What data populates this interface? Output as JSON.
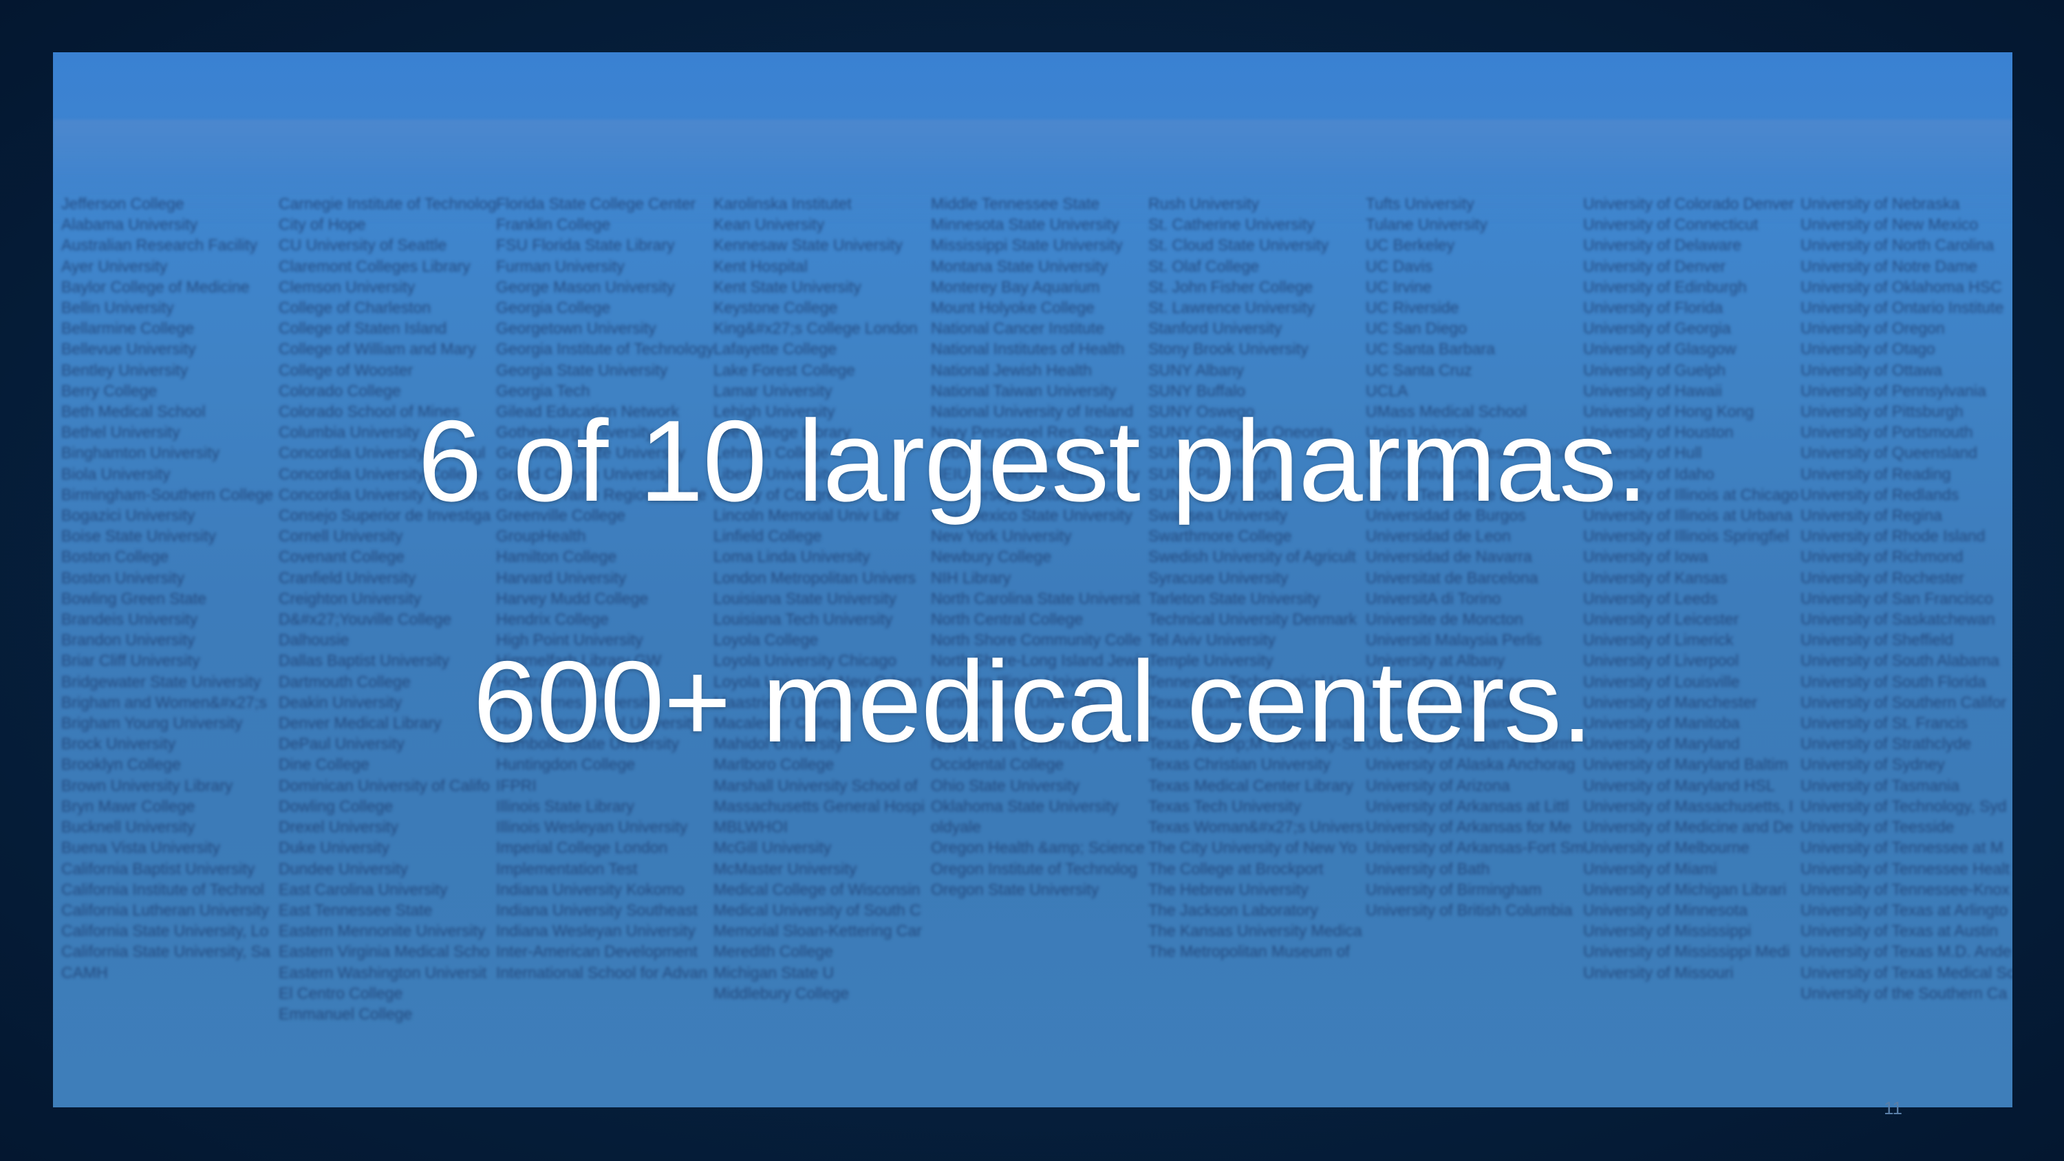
{
  "slide": {
    "headline_1": "6 of 10 largest pharmas.",
    "headline_2": "600+ medical centers.",
    "slide_number": "11"
  },
  "colors": {
    "outer_background": "#06203d",
    "slide_background": "#3d7cbb",
    "headline_text": "#ffffff",
    "list_text": "#1e3f73"
  },
  "institution_columns": [
    {
      "items": [
        "Jefferson College",
        "Alabama University",
        "Australian Research Facility",
        "Ayer University",
        "Baylor College of Medicine",
        "Bellin University",
        "Bellarmine College",
        "Bellevue University",
        "Bentley University",
        "Berry College",
        "Beth Medical School",
        "Bethel University",
        "Binghamton University",
        "Biola University",
        "Birmingham-Southern College",
        "Bogazici University",
        "Boise State University",
        "Boston College",
        "Boston University",
        "Bowling Green State",
        "Brandeis University",
        "Brandon University",
        "Briar Cliff University",
        "Bridgewater State University",
        "Brigham and Women&#x27;s",
        "Brigham Young University",
        "Brock University",
        "Brooklyn College",
        "Brown University Library",
        "Bryn Mawr College",
        "Bucknell University",
        "Buena Vista University",
        "California Baptist University",
        "California Institute of Technol",
        "California Lutheran University",
        "California State University, Lo",
        "California State University, Sa",
        "CAMH"
      ]
    },
    {
      "items": [
        "Carnegie Institute of Technology",
        "City of Hope",
        "CU University of Seattle",
        "Claremont Colleges Library",
        "Clemson University",
        "College of Charleston",
        "College of Staten Island",
        "College of William and Mary",
        "College of Wooster",
        "Colorado College",
        "Colorado School of Mines",
        "Columbia University",
        "Concordia University-St. Paul",
        "Concordia University College",
        "Concordia University Wiscons",
        "Consejo Superior de Investiga",
        "Cornell University",
        "Covenant College",
        "Cranfield University",
        "Creighton University",
        "D&#x27;Youville College",
        "Dalhousie",
        "Dallas Baptist University",
        "Dartmouth College",
        "Deakin University",
        "Denver Medical Library",
        "DePaul University",
        "Dine College",
        "Dominican University of Califo",
        "Dowling College",
        "Drexel University",
        "Duke University",
        "Dundee University",
        "East Carolina University",
        "East Tennessee State",
        "Eastern Mennonite University",
        "Eastern Virginia Medical Scho",
        "Eastern Washington Universit",
        "El Centro College",
        "Emmanuel College"
      ]
    },
    {
      "items": [
        "Florida State College Center",
        "Franklin College",
        "FSU Florida State Library",
        "Furman University",
        "George Mason University",
        "Georgia College",
        "Georgetown University",
        "Georgia Institute of Technology",
        "Georgia State University",
        "Georgia Tech",
        "Gilead Education Network",
        "Gothenburg University",
        "Governors State University",
        "Grand Canyon University",
        "Grande Prairie Regional Colle",
        "Greenville College",
        "GroupHealth",
        "Hamilton College",
        "Harvard University",
        "Harvey Mudd College",
        "Hendrix College",
        "High Point University",
        "Himmelfarb Library GW",
        "Hofstra University",
        "Holy Names University",
        "Hope International University",
        "Humboldt State University",
        "Huntingdon College",
        "IFPRI",
        "Illinois State Library",
        "Illinois Wesleyan University",
        "Imperial College London",
        "Implementation Test",
        "Indiana University Kokomo",
        "Indiana University Southeast",
        "Indiana Wesleyan University",
        "Inter-American Development",
        "International School for Advan"
      ]
    },
    {
      "items": [
        "Karolinska Institutet",
        "Kean University",
        "Kennesaw State University",
        "Kent Hospital",
        "Kent State University",
        "Keystone College",
        "King&#x27;s College London",
        "Lafayette College",
        "Lake Forest College",
        "Lamar University",
        "Lehigh University",
        "Lee College Library",
        "Lehman College",
        "Liberty University",
        "Library of Congress",
        "Lincoln Memorial Univ Libr",
        "Linfield College",
        "Loma Linda University",
        "London Metropolitan Univers",
        "Louisiana State University",
        "Louisiana Tech University",
        "Loyola College",
        "Loyola University Chicago",
        "Loyola University New Orlean",
        "Maastricht University",
        "Macalester College",
        "Mahidol University",
        "Marlboro College",
        "Marshall University School of",
        "Massachusetts General Hospi",
        "MBLWHOI",
        "McGill University",
        "McMaster University",
        "Medical College of Wisconsin",
        "Medical University of South C",
        "Memorial Sloan-Kettering Car",
        "Meredith College",
        "Michigan State U",
        "Middlebury College"
      ]
    },
    {
      "items": [
        "Middle Tennessee State",
        "Minnesota State University",
        "Mississippi State University",
        "Montana State University",
        "Monterey Bay Aquarium",
        "Mount Holyoke College",
        "National Cancer Institute",
        "National Institutes of Health",
        "National Jewish Health",
        "National Taiwan University",
        "National University of Ireland",
        "Navy Personnel Res, Studies,",
        "Nebraska Methodist College",
        "NEIU Ronald Williams Library",
        "New Jersey Institute of Techn",
        "New Mexico State University",
        "New York University",
        "Newbury College",
        "NIH Library",
        "North Carolina State Universit",
        "North Central College",
        "North Shore Community Colle",
        "North Shore-Long Island Jewis",
        "Northern Illinois University",
        "Northwestern University",
        "Norwich University",
        "Nova Scotia Community Colle",
        "Occidental College",
        "Ohio State University",
        "Oklahoma State University",
        "oldyale",
        "Oregon Health &amp; Science",
        "Oregon Institute of Technolog",
        "Oregon State University"
      ]
    },
    {
      "items": [
        "Rush University",
        "St. Catherine University",
        "St. Cloud State University",
        "St. Olaf College",
        "St. John Fisher College",
        "St. Lawrence University",
        "Stanford University",
        "Stony Brook University",
        "SUNY Albany",
        "SUNY Buffalo",
        "SUNY Oswego",
        "SUNY College at Oneonta",
        "SUNY Optometry",
        "SUNY Plattsburgh",
        "SUNY Stony Brook",
        "Swansea University",
        "Swarthmore College",
        "Swedish University of Agricult",
        "Syracuse University",
        "Tarleton State University",
        "Technical University Denmark",
        "Tel Aviv University",
        "Temple University",
        "Tennessee Technological Univ",
        "Texas A&amp;M",
        "Texas A&amp;M International",
        "Texas A&amp;M University-Sa",
        "Texas Christian University",
        "Texas Medical Center Library",
        "Texas Tech University",
        "Texas Woman&#x27;s Univers",
        "The City University of New Yo",
        "The College at Brockport",
        "The Hebrew University",
        "The Jackson Laboratory",
        "The Kansas University Medica",
        "The Metropolitan Museum of"
      ]
    },
    {
      "items": [
        "Tufts University",
        "Tulane University",
        "UC Berkeley",
        "UC Davis",
        "UC Irvine",
        "UC Riverside",
        "UC San Diego",
        "UC Santa Barbara",
        "UC Santa Cruz",
        "UCLA",
        "UMass Medical School",
        "Union University",
        "Uniformed Services University",
        "Union University",
        "Univ of Tennessee at Chattan",
        "Universidad de Burgos",
        "Universidad de Leon",
        "Universidad de Navarra",
        "Universitat de Barcelona",
        "UniversitA di Torino",
        "Universite de Moncton",
        "Universiti Malaysia Perlis",
        "University at Albany",
        "University of Aberdeen",
        "University of Adelaide",
        "University of Alabama",
        "University of Alabama at Birm",
        "University of Alaska Anchorag",
        "University of Arizona",
        "University of Arkansas at Littl",
        "University of Arkansas for Me",
        "University of Arkansas-Fort Sm",
        "University of Bath",
        "University of Birmingham",
        "University of British Columbia"
      ]
    },
    {
      "items": [
        "University of Colorado Denver",
        "University of Connecticut",
        "University of Delaware",
        "University of Denver",
        "University of Edinburgh",
        "University of Florida",
        "University of Georgia",
        "University of Glasgow",
        "University of Guelph",
        "University of Hawaii",
        "University of Hong Kong",
        "University of Houston",
        "University of Hull",
        "University of Idaho",
        "University of Illinois at Chicago",
        "University of Illinois at Urbana",
        "University of Illinois Springfiel",
        "University of Iowa",
        "University of Kansas",
        "University of Leeds",
        "University of Leicester",
        "University of Limerick",
        "University of Liverpool",
        "University of Louisville",
        "University of Manchester",
        "University of Manitoba",
        "University of Maryland",
        "University of Maryland Baltim",
        "University of Maryland HSL",
        "University of Massachusetts, I",
        "University of Medicine and De",
        "University of Melbourne",
        "University of Miami",
        "University of Michigan Librari",
        "University of Minnesota",
        "University of Mississippi",
        "University of Mississippi Medi",
        "University of Missouri"
      ]
    },
    {
      "items": [
        "University of Nebraska",
        "University of New Mexico",
        "University of North Carolina",
        "University of Notre Dame",
        "University of Oklahoma HSC",
        "University of Ontario Institute",
        "University of Oregon",
        "University of Otago",
        "University of Ottawa",
        "University of Pennsylvania",
        "University of Pittsburgh",
        "University of Portsmouth",
        "University of Queensland",
        "University of Reading",
        "University of Redlands",
        "University of Regina",
        "University of Rhode Island",
        "University of Richmond",
        "University of Rochester",
        "University of San Francisco",
        "University of Saskatchewan",
        "University of Sheffield",
        "University of South Alabama",
        "University of South Florida",
        "University of Southern Califor",
        "University of St. Francis",
        "University of Strathclyde",
        "University of Sydney",
        "University of Tasmania",
        "University of Technology, Syd",
        "University of Teesside",
        "University of Tennessee at M",
        "University of Tennessee Healt",
        "University of Tennessee-Knox",
        "University of Texas at Arlingto",
        "University of Texas at Austin",
        "University of Texas M.D. Ande",
        "University of Texas Medical Sc",
        "University of the Southern Ca"
      ]
    }
  ]
}
